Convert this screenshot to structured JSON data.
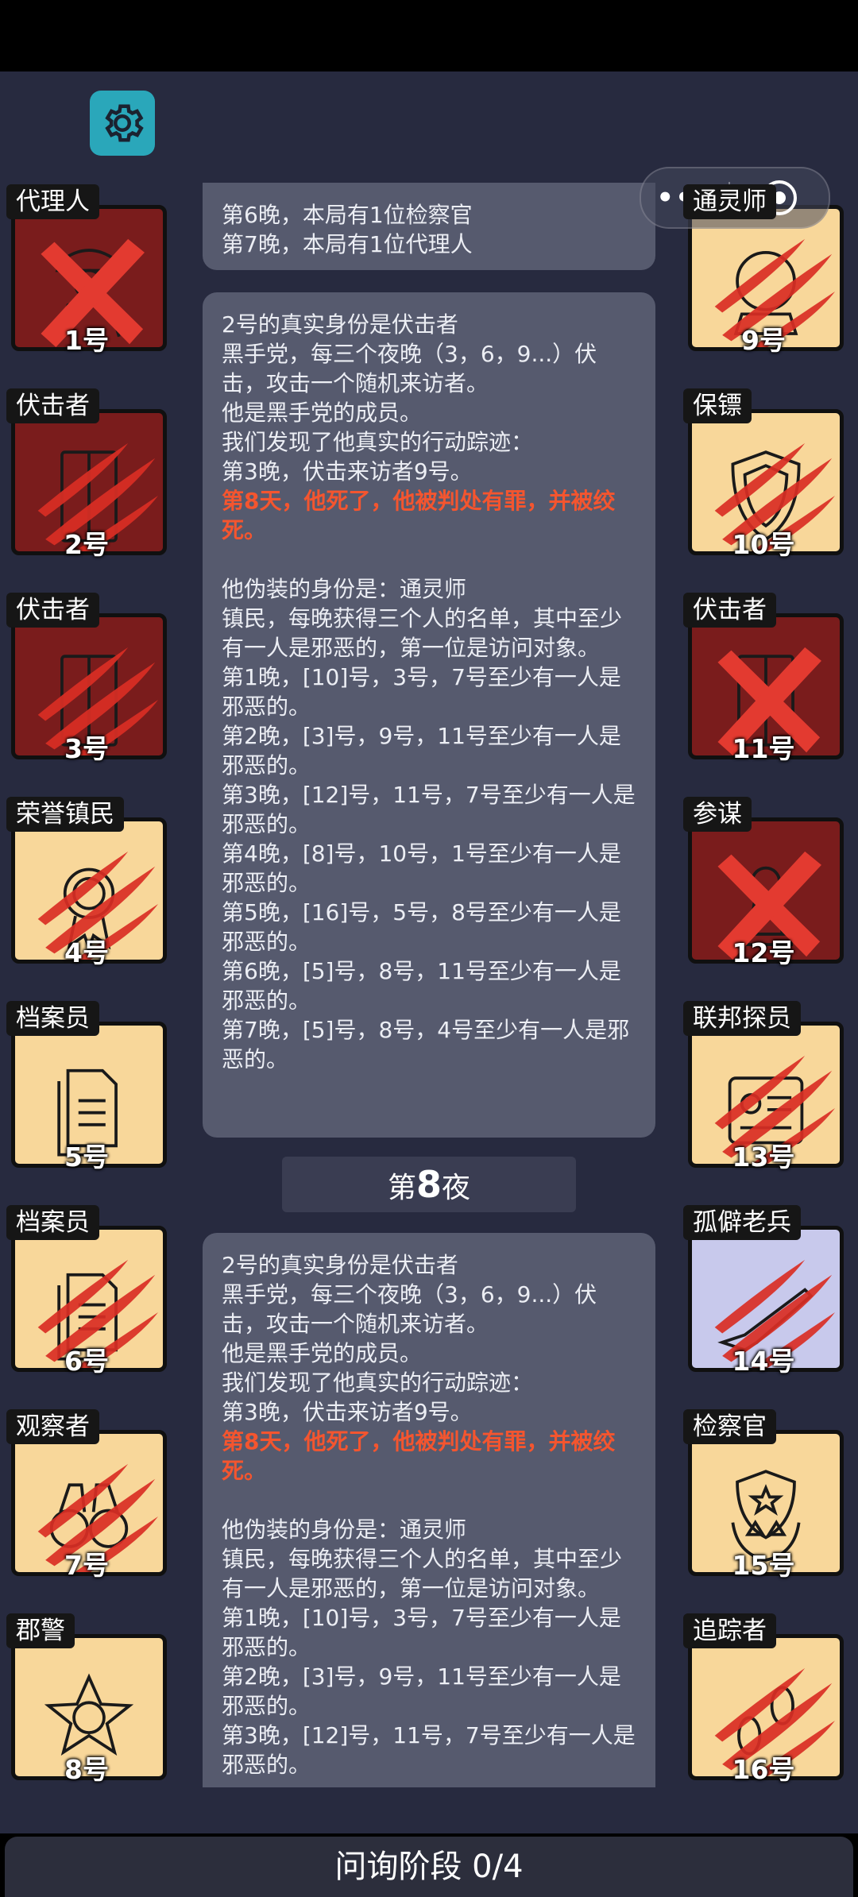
{
  "top_panel_lines": [
    "第6晚，本局有1位检察官",
    "第7晚，本局有1位代理人"
  ],
  "message_1": {
    "head": [
      "2号的真实身份是伏击者",
      "黑手党，每三个夜晚（3，6，9...）伏击，攻击一个随机来访者。",
      "他是黑手党的成员。",
      "我们发现了他真实的行动踪迹：",
      "第3晚，伏击来访者9号。"
    ],
    "death": "第8天，他死了，他被判处有罪，并被绞死。",
    "fake_head": [
      "他伪装的身份是：通灵师",
      "镇民，每晚获得三个人的名单，其中至少有一人是邪恶的，第一位是访问对象。"
    ],
    "nights": [
      "第1晚，[10]号，3号，7号至少有一人是邪恶的。",
      "第2晚，[3]号，9号，11号至少有一人是邪恶的。",
      "第3晚，[12]号，11号，7号至少有一人是邪恶的。",
      "第4晚，[8]号，10号，1号至少有一人是邪恶的。",
      "第5晚，[16]号，5号，8号至少有一人是邪恶的。",
      "第6晚，[5]号，8号，11号至少有一人是邪恶的。",
      "第7晚，[5]号，8号，4号至少有一人是邪恶的。"
    ]
  },
  "night_header": {
    "prefix": "第",
    "number": "8",
    "suffix": "夜"
  },
  "message_2": {
    "head": [
      "2号的真实身份是伏击者",
      "黑手党，每三个夜晚（3，6，9...）伏击，攻击一个随机来访者。",
      "他是黑手党的成员。",
      "我们发现了他真实的行动踪迹：",
      "第3晚，伏击来访者9号。"
    ],
    "death": "第8天，他死了，他被判处有罪，并被绞死。",
    "fake_head": [
      "他伪装的身份是：通灵师",
      "镇民，每晚获得三个人的名单，其中至少有一人是邪恶的，第一位是访问对象。"
    ],
    "nights": [
      "第1晚，[10]号，3号，7号至少有一人是邪恶的。",
      "第2晚，[3]号，9号，11号至少有一人是邪恶的。",
      "第3晚，[12]号，11号，7号至少有一人是邪恶的。"
    ]
  },
  "phase_label": "问询阶段 0/4",
  "miniprogram": {
    "dots": "•••"
  },
  "players_left": [
    {
      "role": "代理人",
      "num": "1号",
      "state": "dead",
      "mark": "x",
      "icon": "detective-icon"
    },
    {
      "role": "伏击者",
      "num": "2号",
      "state": "dead",
      "mark": "claw",
      "icon": "door-icon"
    },
    {
      "role": "伏击者",
      "num": "3号",
      "state": "dead",
      "mark": "claw",
      "icon": "door-icon"
    },
    {
      "role": "荣誉镇民",
      "num": "4号",
      "state": "alive",
      "mark": "claw",
      "icon": "medal-icon"
    },
    {
      "role": "档案员",
      "num": "5号",
      "state": "alive",
      "mark": "none",
      "icon": "documents-icon"
    },
    {
      "role": "档案员",
      "num": "6号",
      "state": "alive",
      "mark": "claw",
      "icon": "documents-icon"
    },
    {
      "role": "观察者",
      "num": "7号",
      "state": "alive",
      "mark": "claw",
      "icon": "binoculars-icon"
    },
    {
      "role": "郡警",
      "num": "8号",
      "state": "alive",
      "mark": "none",
      "icon": "sheriff-badge-icon"
    }
  ],
  "players_right": [
    {
      "role": "通灵师",
      "num": "9号",
      "state": "alive",
      "mark": "claw",
      "icon": "crystal-ball-icon"
    },
    {
      "role": "保镖",
      "num": "10号",
      "state": "alive",
      "mark": "claw",
      "icon": "shield-icon"
    },
    {
      "role": "伏击者",
      "num": "11号",
      "state": "dead",
      "mark": "x",
      "icon": "door-icon"
    },
    {
      "role": "参谋",
      "num": "12号",
      "state": "dead",
      "mark": "x",
      "icon": "pawn-icon"
    },
    {
      "role": "联邦探员",
      "num": "13号",
      "state": "alive",
      "mark": "claw",
      "icon": "id-card-icon"
    },
    {
      "role": "孤僻老兵",
      "num": "14号",
      "state": "lav",
      "mark": "claw",
      "icon": "rifle-icon"
    },
    {
      "role": "检察官",
      "num": "15号",
      "state": "alive",
      "mark": "none",
      "icon": "scales-emblem-icon"
    },
    {
      "role": "追踪者",
      "num": "16号",
      "state": "alive",
      "mark": "claw",
      "icon": "footprints-icon"
    }
  ],
  "colors": {
    "background": "#272a3f",
    "panel": "#565a6e",
    "highlight": "#f4552f",
    "card_alive": "#f8d79a",
    "card_dead": "#7a1c1c",
    "gear": "#2aa7ba"
  }
}
